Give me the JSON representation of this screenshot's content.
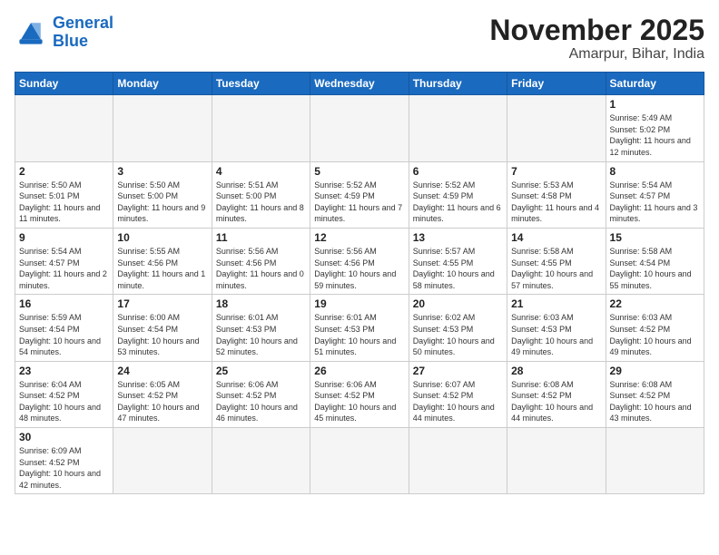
{
  "header": {
    "logo_line1": "General",
    "logo_line2": "Blue",
    "title": "November 2025",
    "subtitle": "Amarpur, Bihar, India"
  },
  "days_of_week": [
    "Sunday",
    "Monday",
    "Tuesday",
    "Wednesday",
    "Thursday",
    "Friday",
    "Saturday"
  ],
  "weeks": [
    [
      {
        "day": "",
        "info": ""
      },
      {
        "day": "",
        "info": ""
      },
      {
        "day": "",
        "info": ""
      },
      {
        "day": "",
        "info": ""
      },
      {
        "day": "",
        "info": ""
      },
      {
        "day": "",
        "info": ""
      },
      {
        "day": "1",
        "info": "Sunrise: 5:49 AM\nSunset: 5:02 PM\nDaylight: 11 hours\nand 12 minutes."
      }
    ],
    [
      {
        "day": "2",
        "info": "Sunrise: 5:50 AM\nSunset: 5:01 PM\nDaylight: 11 hours\nand 11 minutes."
      },
      {
        "day": "3",
        "info": "Sunrise: 5:50 AM\nSunset: 5:00 PM\nDaylight: 11 hours\nand 9 minutes."
      },
      {
        "day": "4",
        "info": "Sunrise: 5:51 AM\nSunset: 5:00 PM\nDaylight: 11 hours\nand 8 minutes."
      },
      {
        "day": "5",
        "info": "Sunrise: 5:52 AM\nSunset: 4:59 PM\nDaylight: 11 hours\nand 7 minutes."
      },
      {
        "day": "6",
        "info": "Sunrise: 5:52 AM\nSunset: 4:59 PM\nDaylight: 11 hours\nand 6 minutes."
      },
      {
        "day": "7",
        "info": "Sunrise: 5:53 AM\nSunset: 4:58 PM\nDaylight: 11 hours\nand 4 minutes."
      },
      {
        "day": "8",
        "info": "Sunrise: 5:54 AM\nSunset: 4:57 PM\nDaylight: 11 hours\nand 3 minutes."
      }
    ],
    [
      {
        "day": "9",
        "info": "Sunrise: 5:54 AM\nSunset: 4:57 PM\nDaylight: 11 hours\nand 2 minutes."
      },
      {
        "day": "10",
        "info": "Sunrise: 5:55 AM\nSunset: 4:56 PM\nDaylight: 11 hours\nand 1 minute."
      },
      {
        "day": "11",
        "info": "Sunrise: 5:56 AM\nSunset: 4:56 PM\nDaylight: 11 hours\nand 0 minutes."
      },
      {
        "day": "12",
        "info": "Sunrise: 5:56 AM\nSunset: 4:56 PM\nDaylight: 10 hours\nand 59 minutes."
      },
      {
        "day": "13",
        "info": "Sunrise: 5:57 AM\nSunset: 4:55 PM\nDaylight: 10 hours\nand 58 minutes."
      },
      {
        "day": "14",
        "info": "Sunrise: 5:58 AM\nSunset: 4:55 PM\nDaylight: 10 hours\nand 57 minutes."
      },
      {
        "day": "15",
        "info": "Sunrise: 5:58 AM\nSunset: 4:54 PM\nDaylight: 10 hours\nand 55 minutes."
      }
    ],
    [
      {
        "day": "16",
        "info": "Sunrise: 5:59 AM\nSunset: 4:54 PM\nDaylight: 10 hours\nand 54 minutes."
      },
      {
        "day": "17",
        "info": "Sunrise: 6:00 AM\nSunset: 4:54 PM\nDaylight: 10 hours\nand 53 minutes."
      },
      {
        "day": "18",
        "info": "Sunrise: 6:01 AM\nSunset: 4:53 PM\nDaylight: 10 hours\nand 52 minutes."
      },
      {
        "day": "19",
        "info": "Sunrise: 6:01 AM\nSunset: 4:53 PM\nDaylight: 10 hours\nand 51 minutes."
      },
      {
        "day": "20",
        "info": "Sunrise: 6:02 AM\nSunset: 4:53 PM\nDaylight: 10 hours\nand 50 minutes."
      },
      {
        "day": "21",
        "info": "Sunrise: 6:03 AM\nSunset: 4:53 PM\nDaylight: 10 hours\nand 49 minutes."
      },
      {
        "day": "22",
        "info": "Sunrise: 6:03 AM\nSunset: 4:52 PM\nDaylight: 10 hours\nand 49 minutes."
      }
    ],
    [
      {
        "day": "23",
        "info": "Sunrise: 6:04 AM\nSunset: 4:52 PM\nDaylight: 10 hours\nand 48 minutes."
      },
      {
        "day": "24",
        "info": "Sunrise: 6:05 AM\nSunset: 4:52 PM\nDaylight: 10 hours\nand 47 minutes."
      },
      {
        "day": "25",
        "info": "Sunrise: 6:06 AM\nSunset: 4:52 PM\nDaylight: 10 hours\nand 46 minutes."
      },
      {
        "day": "26",
        "info": "Sunrise: 6:06 AM\nSunset: 4:52 PM\nDaylight: 10 hours\nand 45 minutes."
      },
      {
        "day": "27",
        "info": "Sunrise: 6:07 AM\nSunset: 4:52 PM\nDaylight: 10 hours\nand 44 minutes."
      },
      {
        "day": "28",
        "info": "Sunrise: 6:08 AM\nSunset: 4:52 PM\nDaylight: 10 hours\nand 44 minutes."
      },
      {
        "day": "29",
        "info": "Sunrise: 6:08 AM\nSunset: 4:52 PM\nDaylight: 10 hours\nand 43 minutes."
      }
    ],
    [
      {
        "day": "30",
        "info": "Sunrise: 6:09 AM\nSunset: 4:52 PM\nDaylight: 10 hours\nand 42 minutes."
      },
      {
        "day": "",
        "info": ""
      },
      {
        "day": "",
        "info": ""
      },
      {
        "day": "",
        "info": ""
      },
      {
        "day": "",
        "info": ""
      },
      {
        "day": "",
        "info": ""
      },
      {
        "day": "",
        "info": ""
      }
    ]
  ]
}
